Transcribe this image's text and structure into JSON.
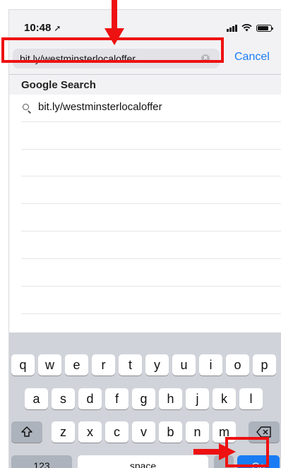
{
  "status_bar": {
    "time": "10:48",
    "location_arrow": "location-arrow-icon"
  },
  "url_bar": {
    "value": "bit.ly/westminsterlocaloffer",
    "cancel_label": "Cancel"
  },
  "suggestions": {
    "header": "Google Search",
    "items": [
      {
        "icon": "search-icon",
        "text": "bit.ly/westminsterlocaloffer"
      }
    ]
  },
  "keyboard": {
    "row1": [
      "q",
      "w",
      "e",
      "r",
      "t",
      "y",
      "u",
      "i",
      "o",
      "p"
    ],
    "row2": [
      "a",
      "s",
      "d",
      "f",
      "g",
      "h",
      "j",
      "k",
      "l"
    ],
    "row3": [
      "z",
      "x",
      "c",
      "v",
      "b",
      "n",
      "m"
    ],
    "numbers_label": "123",
    "space_label": "space",
    "go_label": "Go"
  },
  "annotations": {
    "arrow_color": "#ee1111",
    "highlight_color": "#ee1111"
  },
  "colors": {
    "accent": "#1a7cf4",
    "keyboard_bg": "#d0d3d9"
  }
}
